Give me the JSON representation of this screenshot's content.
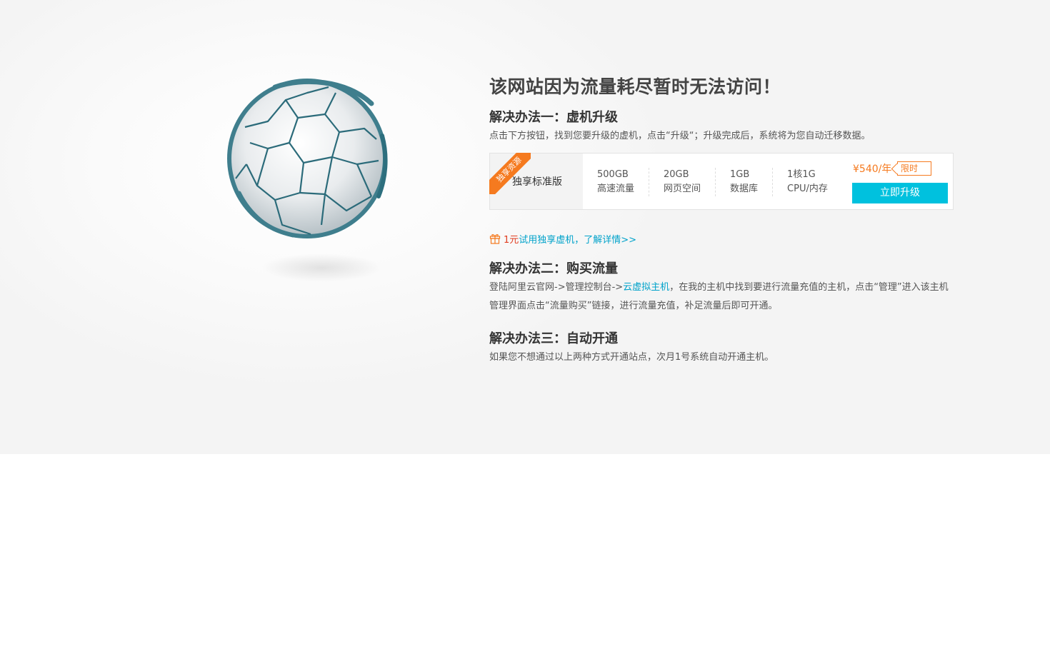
{
  "page": {
    "title": "该网站因为流量耗尽暂时无法访问！"
  },
  "solution1": {
    "title": "解决办法一：虚机升级",
    "desc": "点击下方按钮，找到您要升级的虚机，点击“升级“；升级完成后，系统将为您自动迁移数据。"
  },
  "product": {
    "ribbon": "独享资源",
    "name": "独享标准版",
    "specs": [
      {
        "value": "500GB",
        "label": "高速流量"
      },
      {
        "value": "20GB",
        "label": "网页空间"
      },
      {
        "value": "1GB",
        "label": "数据库"
      },
      {
        "value": "1核1G",
        "label": "CPU/内存"
      }
    ],
    "price": "¥540/年",
    "limit_tag": "限时",
    "button": "立即升级"
  },
  "promo": {
    "price": "1元",
    "link": "试用独享虚机，了解详情>>"
  },
  "solution2": {
    "title": "解决办法二：购买流量",
    "desc_before": "登陆阿里云官网->管理控制台->",
    "link": "云虚拟主机",
    "desc_after": "，在我的主机中找到要进行流量充值的主机，点击“管理”进入该主机管理界面点击“流量购买”链接，进行流量充值，补足流量后即可开通。"
  },
  "solution3": {
    "title": "解决办法三：自动开通",
    "desc": "如果您不想通过以上两种方式开通站点，次月1号系统自动开通主机。"
  },
  "colors": {
    "accent": "#00c1de",
    "orange": "#f57a1f",
    "link": "#00a2ca",
    "promo_red": "#e03c1f"
  },
  "icons": {
    "illustration": "cracked-globe-icon",
    "promo": "gift-icon"
  }
}
